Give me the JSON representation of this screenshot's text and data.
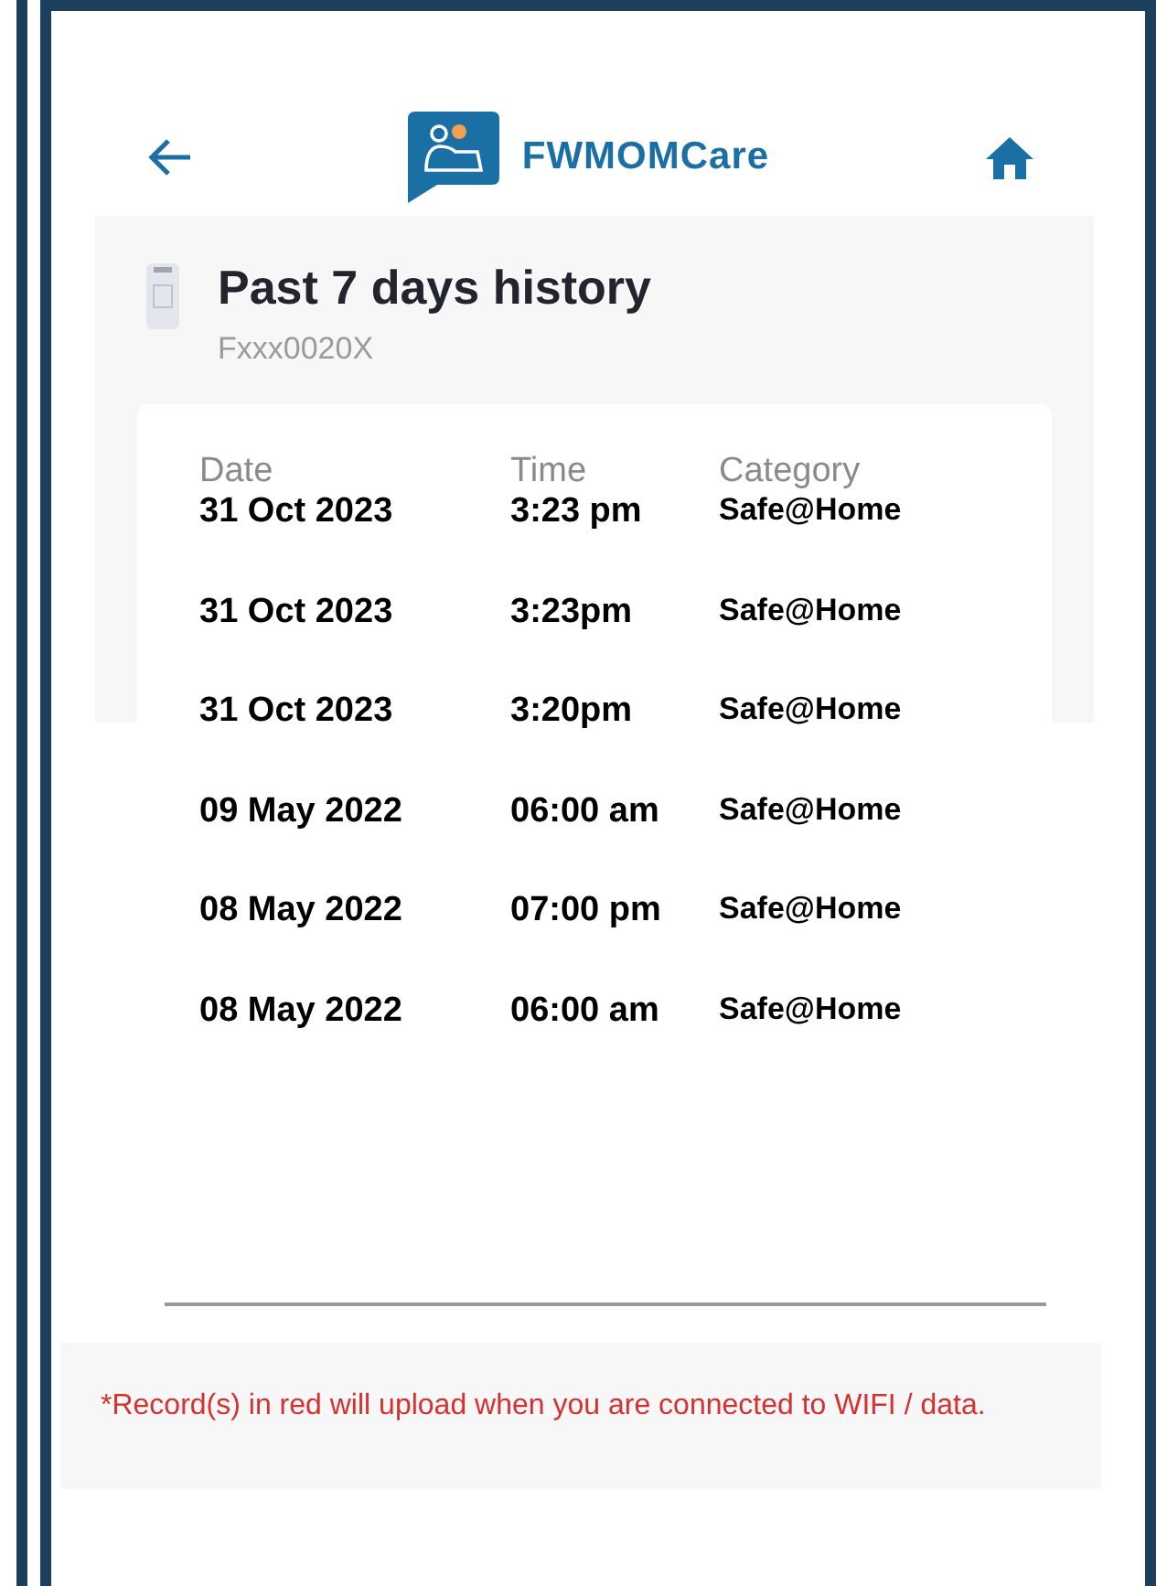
{
  "app_bar": {
    "title": "FWMOMCare"
  },
  "history": {
    "title": "Past 7 days history",
    "device_id": "Fxxx0020X",
    "columns": [
      "Date",
      "Time",
      "Category"
    ],
    "rows": [
      {
        "date": "31 Oct 2023",
        "time": "3:23 pm",
        "category": "Safe@Home"
      },
      {
        "date": "31 Oct 2023",
        "time": "3:23pm",
        "category": "Safe@Home"
      },
      {
        "date": "31 Oct 2023",
        "time": "3:20pm",
        "category": "Safe@Home"
      },
      {
        "date": "09 May 2022",
        "time": "06:00 am",
        "category": "Safe@Home"
      },
      {
        "date": "08 May 2022",
        "time": "07:00 pm",
        "category": "Safe@Home"
      },
      {
        "date": "08 May 2022",
        "time": "06:00 am",
        "category": "Safe@Home"
      }
    ]
  },
  "note": "*Record(s) in red will upload when you are connected to WIFI / data."
}
